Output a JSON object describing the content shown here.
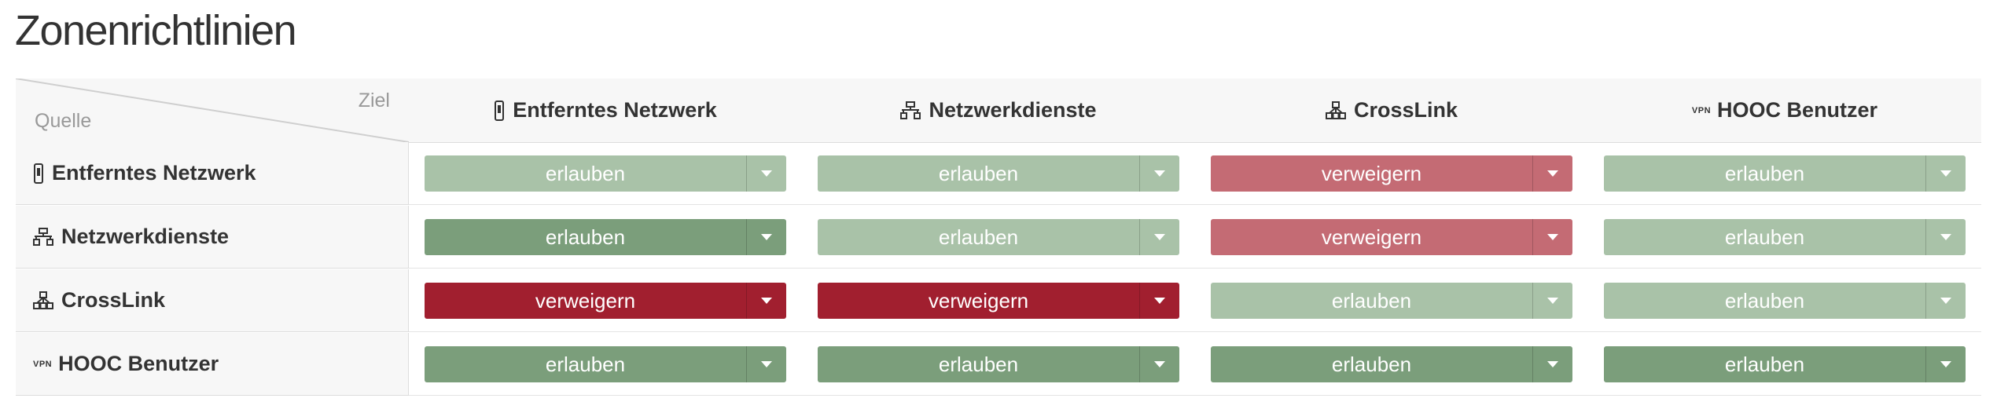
{
  "page": {
    "title": "Zonenrichtlinien"
  },
  "corner": {
    "target_label": "Ziel",
    "source_label": "Quelle"
  },
  "zones": [
    {
      "name": "Entferntes Netzwerk",
      "icon": "remote-device-icon"
    },
    {
      "name": "Netzwerkdienste",
      "icon": "network-services-icon"
    },
    {
      "name": "CrossLink",
      "icon": "crosslink-icon"
    },
    {
      "name": "HOOC Benutzer",
      "icon": "vpn-icon",
      "icon_text": "VPN"
    }
  ],
  "colors": {
    "allow_muted": "#a9c2a8",
    "allow_strong": "#7b9e7b",
    "deny_muted": "#c46b74",
    "deny_strong": "#a11f2f"
  },
  "policies": [
    {
      "source": "Entferntes Netzwerk",
      "cells": [
        {
          "label": "erlauben",
          "style": "allow_muted"
        },
        {
          "label": "erlauben",
          "style": "allow_muted"
        },
        {
          "label": "verweigern",
          "style": "deny_muted"
        },
        {
          "label": "erlauben",
          "style": "allow_muted"
        }
      ]
    },
    {
      "source": "Netzwerkdienste",
      "cells": [
        {
          "label": "erlauben",
          "style": "allow_strong"
        },
        {
          "label": "erlauben",
          "style": "allow_muted"
        },
        {
          "label": "verweigern",
          "style": "deny_muted"
        },
        {
          "label": "erlauben",
          "style": "allow_muted"
        }
      ]
    },
    {
      "source": "CrossLink",
      "cells": [
        {
          "label": "verweigern",
          "style": "deny_strong"
        },
        {
          "label": "verweigern",
          "style": "deny_strong"
        },
        {
          "label": "erlauben",
          "style": "allow_muted"
        },
        {
          "label": "erlauben",
          "style": "allow_muted"
        }
      ]
    },
    {
      "source": "HOOC Benutzer",
      "cells": [
        {
          "label": "erlauben",
          "style": "allow_strong"
        },
        {
          "label": "erlauben",
          "style": "allow_strong"
        },
        {
          "label": "erlauben",
          "style": "allow_strong"
        },
        {
          "label": "erlauben",
          "style": "allow_strong"
        }
      ]
    }
  ]
}
